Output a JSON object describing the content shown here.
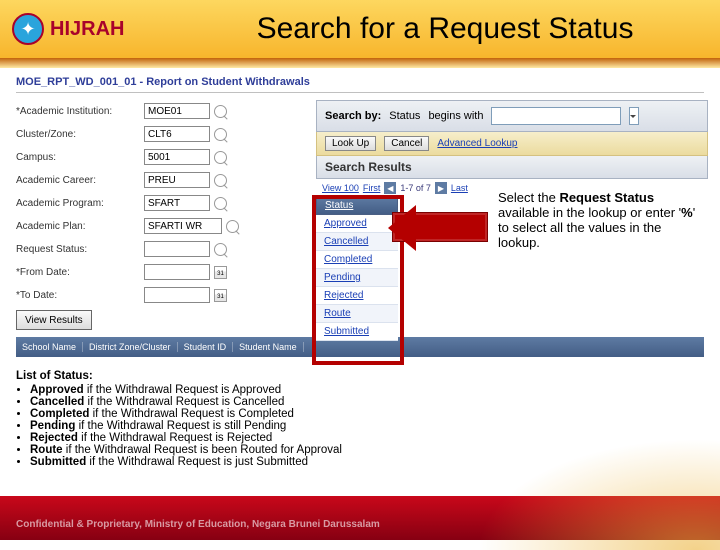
{
  "header": {
    "logo_text": "HIJRAH",
    "title": "Search for a Request Status"
  },
  "report_title": "MOE_RPT_WD_001_01 - Report on Student Withdrawals",
  "form": {
    "academic_institution_label": "*Academic Institution:",
    "academic_institution": "MOE01",
    "cluster_label": "Cluster/Zone:",
    "cluster": "CLT6",
    "campus_label": "Campus:",
    "campus": "5001",
    "career_label": "Academic Career:",
    "career": "PREU",
    "program_label": "Academic Program:",
    "program": "SFART",
    "plan_label": "Academic Plan:",
    "plan": "SFARTI WR",
    "request_status_label": "Request Status:",
    "request_status": "",
    "from_label": "*From Date:",
    "to_label": "*To Date:",
    "view_results_label": "View Results"
  },
  "result_grid": {
    "cols": [
      "School Name",
      "District Zone/Cluster",
      "Student ID",
      "Student Name"
    ]
  },
  "search_overlay": {
    "search_by_label": "Search by:",
    "field_label": "Status",
    "operator": "begins with",
    "lookup_btn": "Look Up",
    "cancel_btn": "Cancel",
    "advanced": "Advanced Lookup",
    "results_title": "Search Results",
    "view_100": "View 100",
    "first": "First",
    "range": "1-7 of 7",
    "last": "Last",
    "column_header": "Status",
    "rows": [
      "Approved",
      "Cancelled",
      "Completed",
      "Pending",
      "Rejected",
      "Route",
      "Submitted"
    ]
  },
  "callout": {
    "line": "Select the ",
    "bold1": "Request Status",
    "mid": " available in the lookup or enter '",
    "bold2": "%",
    "end": "' to select all the values in the lookup."
  },
  "status_list": {
    "title": "List of Status:",
    "items": [
      {
        "b": "Approved",
        "t": " if the Withdrawal Request is Approved"
      },
      {
        "b": "Cancelled",
        "t": " if the Withdrawal Request is Cancelled"
      },
      {
        "b": "Completed",
        "t": " if the Withdrawal Request is Completed"
      },
      {
        "b": "Pending",
        "t": " if the Withdrawal Request is still Pending"
      },
      {
        "b": "Rejected",
        "t": " if the Withdrawal Request is Rejected"
      },
      {
        "b": "Route",
        "t": " if the Withdrawal Request is been Routed for Approval"
      },
      {
        "b": "Submitted",
        "t": " if the Withdrawal Request is just Submitted"
      }
    ]
  },
  "footer": "Confidential & Proprietary, Ministry of Education, Negara Brunei Darussalam"
}
